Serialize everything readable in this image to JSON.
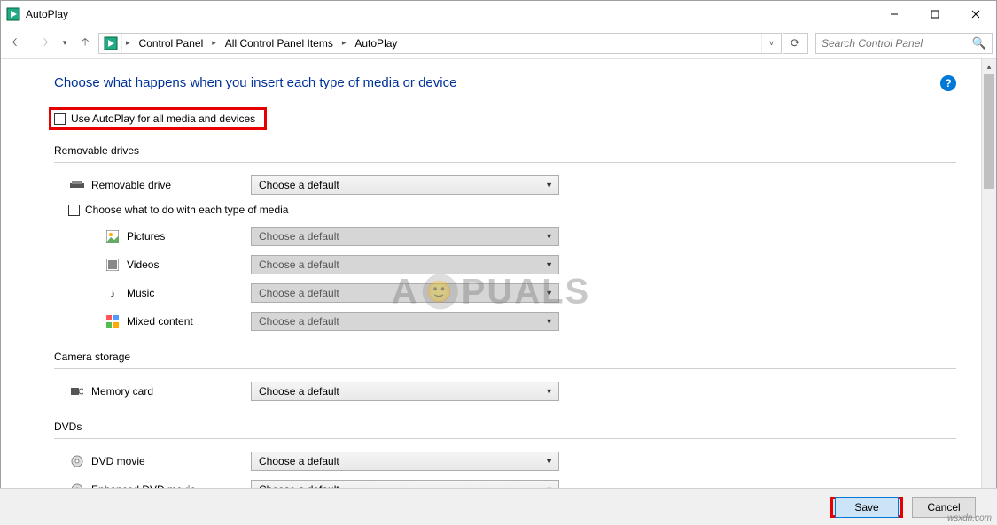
{
  "titlebar": {
    "title": "AutoPlay"
  },
  "breadcrumb": {
    "items": [
      "Control Panel",
      "All Control Panel Items",
      "AutoPlay"
    ]
  },
  "search": {
    "placeholder": "Search Control Panel"
  },
  "page": {
    "title": "Choose what happens when you insert each type of media or device",
    "master_checkbox": "Use AutoPlay for all media and devices",
    "choose_media_checkbox": "Choose what to do with each type of media"
  },
  "combo_default": "Choose a default",
  "sections": {
    "removable": {
      "label": "Removable drives",
      "items": {
        "removable_drive": "Removable drive"
      },
      "media": {
        "pictures": "Pictures",
        "videos": "Videos",
        "music": "Music",
        "mixed": "Mixed content"
      }
    },
    "camera": {
      "label": "Camera storage",
      "items": {
        "memory_card": "Memory card"
      }
    },
    "dvds": {
      "label": "DVDs",
      "items": {
        "dvd_movie": "DVD movie",
        "enhanced_dvd": "Enhanced DVD movie"
      }
    }
  },
  "footer": {
    "save": "Save",
    "cancel": "Cancel"
  },
  "watermark": {
    "left": "A",
    "right": "PUALS"
  },
  "corner_url": "wsxdn.com"
}
